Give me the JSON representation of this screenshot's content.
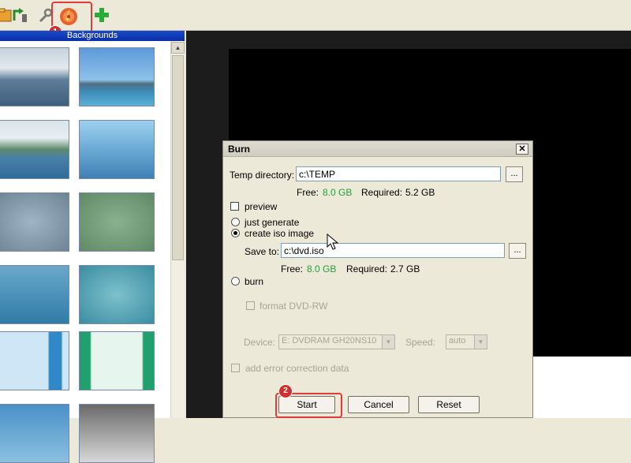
{
  "toolbar": {
    "icons": [
      "open-icon",
      "import-icon",
      "wrench-icon",
      "burn-icon",
      "add-icon"
    ],
    "steps": {
      "step1": "1",
      "step2": "2"
    }
  },
  "backgrounds_panel": {
    "title": "Backgrounds"
  },
  "dialog": {
    "title": "Burn",
    "temp_directory": {
      "label": "Temp directory:",
      "value": "c:\\TEMP",
      "browse_label": "...",
      "free_label": "Free:",
      "free_value": "8.0 GB",
      "required_label": "Required:",
      "required_value": "5.2 GB"
    },
    "preview_label": "preview",
    "just_generate_label": "just generate",
    "create_iso_label": "create iso image",
    "save_to": {
      "label": "Save to:",
      "value": "c:\\dvd.iso",
      "browse_label": "...",
      "free_label": "Free:",
      "free_value": "8.0 GB",
      "required_label": "Required:",
      "required_value": "2.7 GB"
    },
    "burn_label": "burn",
    "format_label": "format DVD-RW",
    "device_label": "Device:",
    "device_value": "E: DVDRAM GH20NS10",
    "speed_label": "Speed:",
    "speed_value": "auto",
    "error_correction_label": "add error correction data",
    "buttons": {
      "start": "Start",
      "cancel": "Cancel",
      "reset": "Reset"
    }
  },
  "colors": {
    "highlight": "#e33a3a",
    "free_text": "#2a9a3a",
    "title_bar": "#0a2fa8"
  }
}
